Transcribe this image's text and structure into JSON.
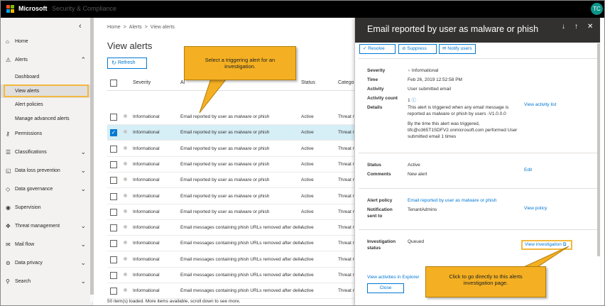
{
  "topbar": {
    "brand": "Microsoft",
    "suite": "Security & Compliance",
    "avatar": "TC"
  },
  "sidebar": {
    "collapse": "‹",
    "items": [
      {
        "label": "Home",
        "icon": "⌂"
      },
      {
        "label": "Alerts",
        "icon": "⚠",
        "chev": "⌃"
      },
      {
        "label": "Permissions",
        "icon": "⚷"
      },
      {
        "label": "Classifications",
        "icon": "☰",
        "chev": "⌄"
      },
      {
        "label": "Data loss prevention",
        "icon": "◱",
        "chev": "⌄"
      },
      {
        "label": "Data governance",
        "icon": "◇",
        "chev": "⌄"
      },
      {
        "label": "Supervision",
        "icon": "◉"
      },
      {
        "label": "Threat management",
        "icon": "✥",
        "chev": "⌄"
      },
      {
        "label": "Mail flow",
        "icon": "✉",
        "chev": "⌄"
      },
      {
        "label": "Data privacy",
        "icon": "⊜",
        "chev": "⌄"
      },
      {
        "label": "Search",
        "icon": "⚲",
        "chev": "⌄"
      }
    ],
    "sub": [
      "Dashboard",
      "View alerts",
      "Alert policies",
      "Manage advanced alerts"
    ]
  },
  "main": {
    "breadcrumb": [
      "Home",
      ">",
      "Alerts",
      ">",
      "View alerts"
    ],
    "title": "View alerts",
    "refresh": "Refresh",
    "refresh_icon": "↻",
    "headers": {
      "severity": "Severity",
      "alert": "Al",
      "status": "Status",
      "category": "Catego"
    },
    "rows": [
      {
        "severity": "Informational",
        "alert": "Email reported by user as malware or phish",
        "status": "Active",
        "category": "Threat m",
        "selected": false
      },
      {
        "severity": "Informational",
        "alert": "Email reported by user as malware or phish",
        "status": "Active",
        "category": "Threat m",
        "selected": true
      },
      {
        "severity": "Informational",
        "alert": "Email reported by user as malware or phish",
        "status": "Active",
        "category": "Threat m",
        "selected": false
      },
      {
        "severity": "Informational",
        "alert": "Email reported by user as malware or phish",
        "status": "Active",
        "category": "Threat m",
        "selected": false
      },
      {
        "severity": "Informational",
        "alert": "Email reported by user as malware or phish",
        "status": "Active",
        "category": "Threat m",
        "selected": false
      },
      {
        "severity": "Informational",
        "alert": "Email reported by user as malware or phish",
        "status": "Active",
        "category": "Threat m",
        "selected": false
      },
      {
        "severity": "Informational",
        "alert": "Email reported by user as malware or phish",
        "status": "Active",
        "category": "Threat m",
        "selected": false
      },
      {
        "severity": "Informational",
        "alert": "Email messages containing phish URLs removed after deliv...",
        "status": "Active",
        "category": "Threat m",
        "selected": false
      },
      {
        "severity": "Informational",
        "alert": "Email messages containing phish URLs removed after deliv...",
        "status": "Active",
        "category": "Threat m",
        "selected": false
      },
      {
        "severity": "Informational",
        "alert": "Email messages containing phish URLs removed after deliv...",
        "status": "Active",
        "category": "Threat m",
        "selected": false
      },
      {
        "severity": "Informational",
        "alert": "Email messages containing phish URLs removed after deliv...",
        "status": "Active",
        "category": "Threat m",
        "selected": false
      },
      {
        "severity": "Informational",
        "alert": "Email messages containing phish URLs removed after deliv...",
        "status": "Active",
        "category": "Threat m",
        "selected": false
      }
    ],
    "footer": "50 item(s) loaded. More items available, scroll down to see more."
  },
  "panel": {
    "title": "Email reported by user as malware or phish",
    "buttons": {
      "down": "↓",
      "up": "↑",
      "close": "✕"
    },
    "actions": [
      {
        "icon": "✓",
        "label": "Resolve"
      },
      {
        "icon": "⊘",
        "label": "Suppress"
      },
      {
        "icon": "✉",
        "label": "Notify users"
      }
    ],
    "severity_label": "Severity",
    "severity": "Informational",
    "time_label": "Time",
    "time": "Feb 26, 2019 12:52:58 PM",
    "activity_label": "Activity",
    "activity": "User submitted email",
    "count_label": "Activity count",
    "count": "1",
    "details_label": "Details",
    "details1": "This alert is triggered when any email message is",
    "details2": "reported as malware or phish by users -V1.0.0.0",
    "details3": "By the time this alert was triggered,",
    "details4": "tifc@o365T1SDFV2.onmicrosoft.com performed User",
    "details5": "submitted email 1 times",
    "view_activity_list": "View activity list",
    "status_label": "Status",
    "status": "Active",
    "comments_label": "Comments",
    "comments": "New alert",
    "edit": "Edit",
    "policy_label": "Alert policy",
    "policy": "Email reported by user as malware or phish",
    "notif_label1": "Notification",
    "notif_label2": "sent to",
    "notif": "TenantAdmins",
    "view_policy": "View policy",
    "inv_label1": "Investigation",
    "inv_label2": "status",
    "inv": "Queued",
    "view_investigation": "View investigation",
    "view_explorer": "View activities in Explorer",
    "close_button": "Close"
  },
  "callouts": {
    "top": "Select a triggering alert for an investigation.",
    "bottom": "Click to go directly to this alerts investigation page."
  },
  "colors": {
    "accent": "#0078d4",
    "callout": "#f4b022",
    "header": "#323130",
    "selected_row": "#d6eef6"
  }
}
